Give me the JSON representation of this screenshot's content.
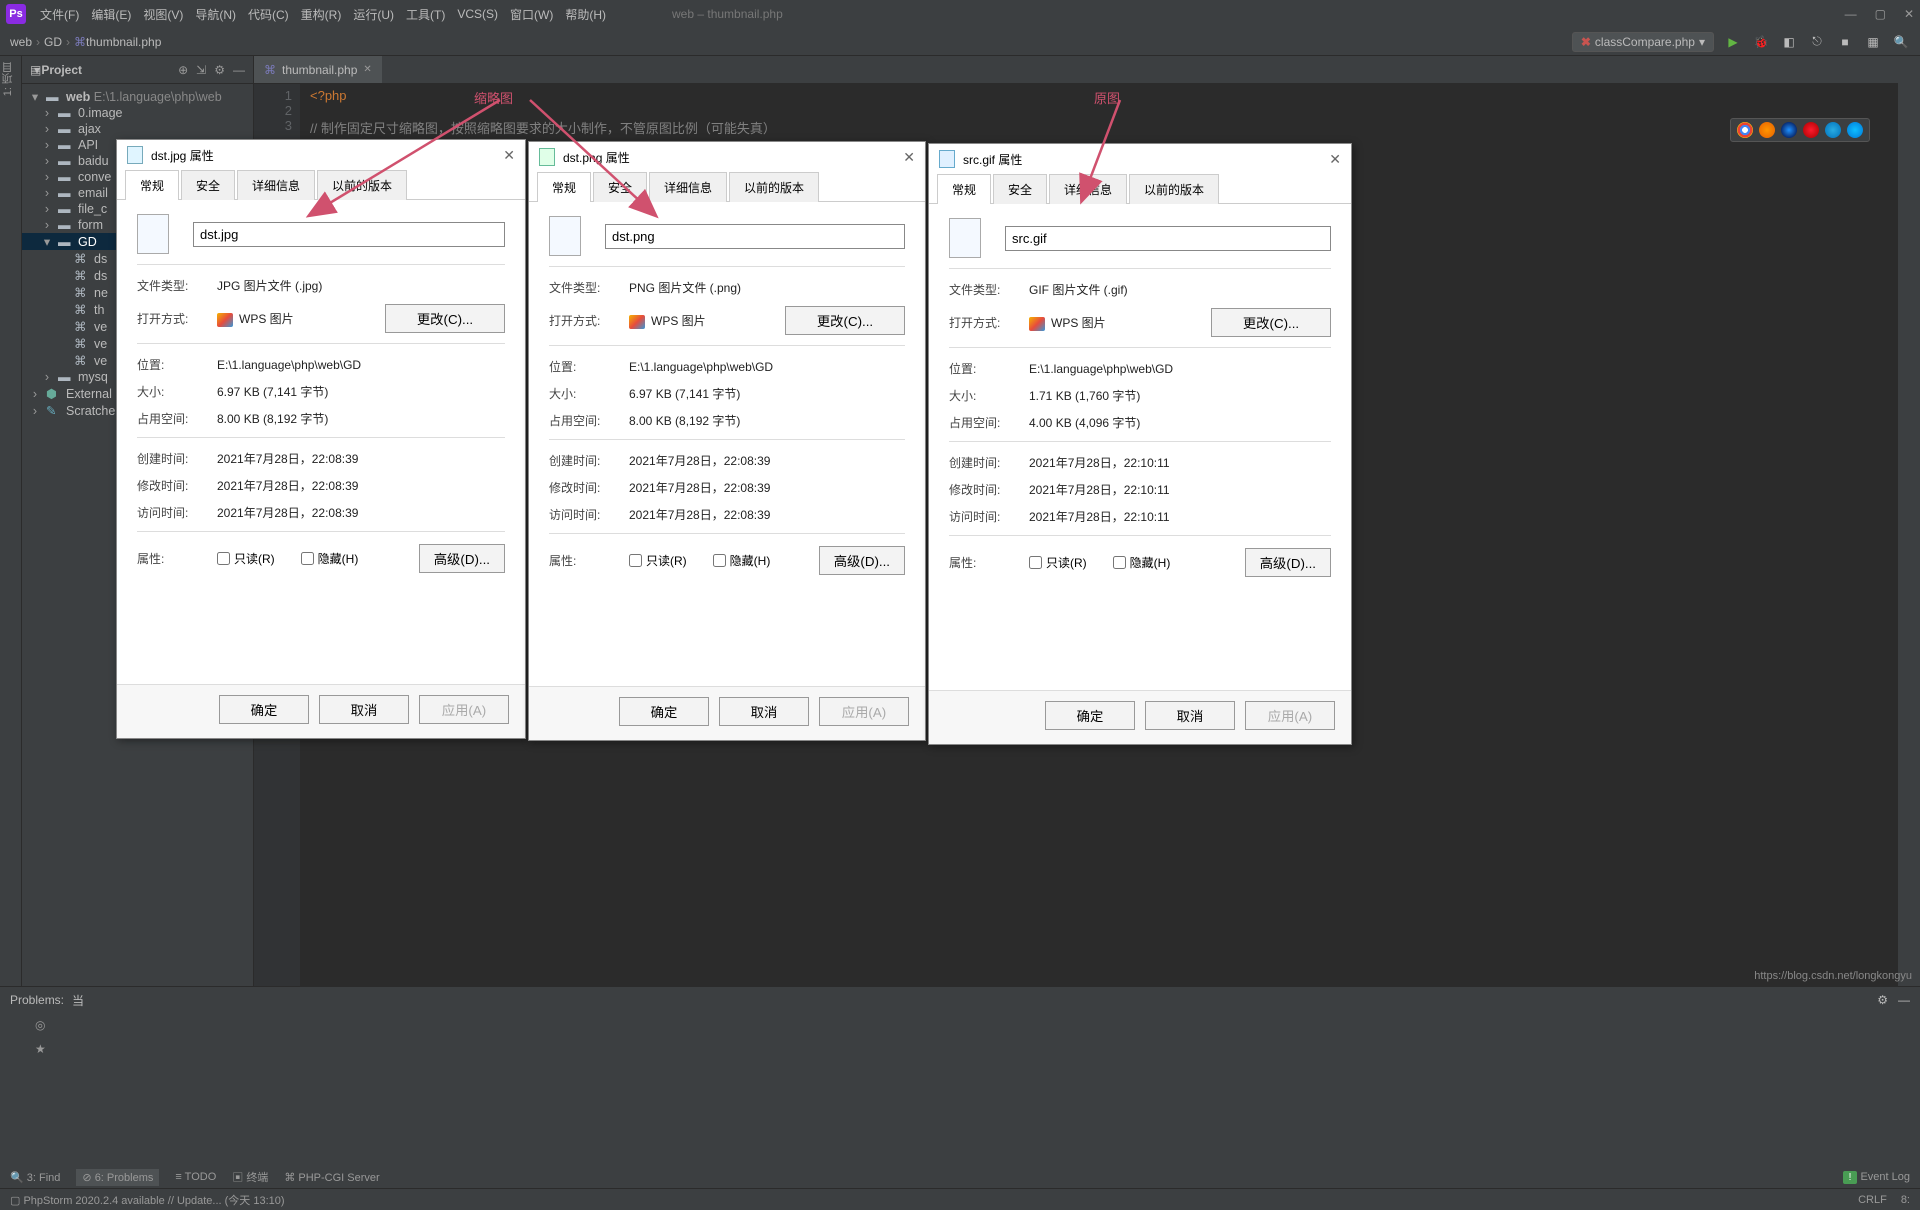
{
  "menubar": {
    "items": [
      "文件(F)",
      "编辑(E)",
      "视图(V)",
      "导航(N)",
      "代码(C)",
      "重构(R)",
      "运行(U)",
      "工具(T)",
      "VCS(S)",
      "窗口(W)",
      "帮助(H)"
    ],
    "window_title": "web – thumbnail.php"
  },
  "breadcrumb": {
    "p0": "web",
    "p1": "GD",
    "p2": "thumbnail.php"
  },
  "run_config": "classCompare.php",
  "project": {
    "title": "Project",
    "root_name": "web",
    "root_path": " E:\\1.language\\php\\web",
    "folders": [
      "0.image",
      "ajax",
      "API",
      "baidu",
      "conve",
      "email",
      "file_c",
      "form"
    ],
    "gd": "GD",
    "gd_files": [
      "ds",
      "ds",
      "ne",
      "th",
      "ve",
      "ve",
      "ve"
    ],
    "mysq": "mysq",
    "external": "External",
    "scratch": "Scratche"
  },
  "editor": {
    "tab": "thumbnail.php",
    "gutter": [
      "1",
      "2",
      "3"
    ],
    "line1": "<?php",
    "line3": "// 制作固定尺寸缩略图，按照缩略图要求的大小制作，不管原图比例（可能失真）",
    "label_thumb": "缩略图",
    "label_src": "原图"
  },
  "problems": {
    "title": "Problems:",
    "sub": "当"
  },
  "bottom_tools": {
    "find": "3: Find",
    "problems": "6: Problems",
    "todo": "TODO",
    "terminal": "终端",
    "php": "PHP-CGI Server",
    "event": "Event Log"
  },
  "status": {
    "update": "PhpStorm 2020.2.4 available // Update... (今天 13:10)",
    "crlf": "CRLF",
    "right2": "8:"
  },
  "labels": {
    "tab_general": "常规",
    "tab_security": "安全",
    "tab_details": "详细信息",
    "tab_prev": "以前的版本",
    "type": "文件类型:",
    "open": "打开方式:",
    "wps": "WPS 图片",
    "change": "更改(C)...",
    "loc": "位置:",
    "size": "大小:",
    "disk": "占用空间:",
    "created": "创建时间:",
    "modified": "修改时间:",
    "accessed": "访问时间:",
    "attr": "属性:",
    "readonly": "只读(R)",
    "hidden": "隐藏(H)",
    "adv": "高级(D)...",
    "ok": "确定",
    "cancel": "取消",
    "apply": "应用(A)",
    "prop_suffix": " 属性"
  },
  "dialogs": [
    {
      "fname": "dst.jpg",
      "ext": "jpg",
      "type_v": "JPG 图片文件 (.jpg)",
      "loc_v": "E:\\1.language\\php\\web\\GD",
      "size_v": "6.97 KB (7,141 字节)",
      "disk_v": "8.00 KB (8,192 字节)",
      "created_v": "2021年7月28日，22:08:39",
      "modified_v": "2021年7月28日，22:08:39",
      "accessed_v": "2021年7月28日，22:08:39"
    },
    {
      "fname": "dst.png",
      "ext": "png",
      "type_v": "PNG 图片文件 (.png)",
      "loc_v": "E:\\1.language\\php\\web\\GD",
      "size_v": "6.97 KB (7,141 字节)",
      "disk_v": "8.00 KB (8,192 字节)",
      "created_v": "2021年7月28日，22:08:39",
      "modified_v": "2021年7月28日，22:08:39",
      "accessed_v": "2021年7月28日，22:08:39"
    },
    {
      "fname": "src.gif",
      "ext": "gif",
      "type_v": "GIF 图片文件 (.gif)",
      "loc_v": "E:\\1.language\\php\\web\\GD",
      "size_v": "1.71 KB (1,760 字节)",
      "disk_v": "4.00 KB (4,096 字节)",
      "created_v": "2021年7月28日，22:10:11",
      "modified_v": "2021年7月28日，22:10:11",
      "accessed_v": "2021年7月28日，22:10:11"
    }
  ],
  "watermark": "https://blog.csdn.net/longkongyu"
}
